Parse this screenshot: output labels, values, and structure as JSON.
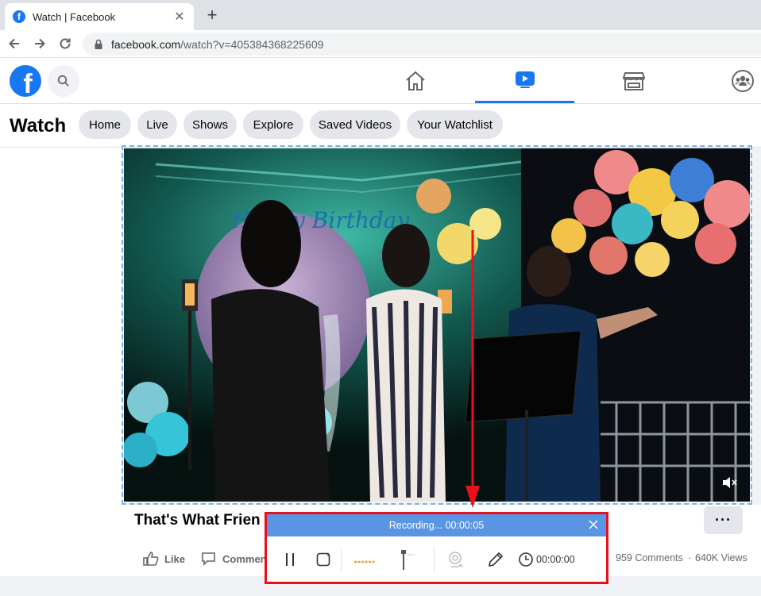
{
  "browser": {
    "tab_title": "Watch | Facebook",
    "url_host": "facebook.com",
    "url_path": "/watch?v=405384368225609"
  },
  "watch": {
    "title": "Watch",
    "tabs": [
      "Home",
      "Live",
      "Shows",
      "Explore",
      "Saved Videos",
      "Your Watchlist"
    ]
  },
  "video": {
    "title": "That's What Frien",
    "like_label": "Like",
    "comment_label": "Commen",
    "comments_count": "959 Comments",
    "views_count": "640K Views",
    "separator": "·",
    "more_label": "···",
    "banner_text": "Happy Birthday"
  },
  "recorder": {
    "status": "Recording... 00:00:05",
    "timer": "00:00:00"
  },
  "colors": {
    "facebook_blue": "#1877f2",
    "recorder_header": "#5a95e4",
    "recorder_border": "#e8101b",
    "selection_border": "#79b4e6"
  }
}
